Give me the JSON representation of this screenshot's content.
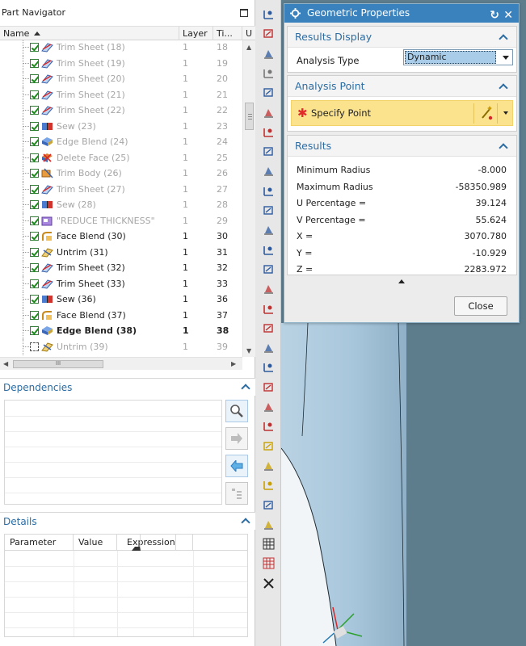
{
  "navigator": {
    "title": "Part Navigator",
    "columns": {
      "name": "Name",
      "layer": "Layer",
      "ti": "Ti...",
      "u": "U"
    },
    "rows": [
      {
        "name": "Trim Sheet (18)",
        "layer": "1",
        "ti": "18",
        "icon": "trim-sheet-icon",
        "dim": true,
        "bold": false
      },
      {
        "name": "Trim Sheet (19)",
        "layer": "1",
        "ti": "19",
        "icon": "trim-sheet-icon",
        "dim": true,
        "bold": false
      },
      {
        "name": "Trim Sheet (20)",
        "layer": "1",
        "ti": "20",
        "icon": "trim-sheet-icon",
        "dim": true,
        "bold": false
      },
      {
        "name": "Trim Sheet (21)",
        "layer": "1",
        "ti": "21",
        "icon": "trim-sheet-icon",
        "dim": true,
        "bold": false
      },
      {
        "name": "Trim Sheet (22)",
        "layer": "1",
        "ti": "22",
        "icon": "trim-sheet-icon",
        "dim": true,
        "bold": false
      },
      {
        "name": "Sew (23)",
        "layer": "1",
        "ti": "23",
        "icon": "sew-icon",
        "dim": true,
        "bold": false
      },
      {
        "name": "Edge Blend (24)",
        "layer": "1",
        "ti": "24",
        "icon": "edge-blend-icon",
        "dim": true,
        "bold": false
      },
      {
        "name": "Delete Face (25)",
        "layer": "1",
        "ti": "25",
        "icon": "delete-face-icon",
        "dim": true,
        "bold": false
      },
      {
        "name": "Trim Body (26)",
        "layer": "1",
        "ti": "26",
        "icon": "trim-body-icon",
        "dim": true,
        "bold": false
      },
      {
        "name": "Trim Sheet (27)",
        "layer": "1",
        "ti": "27",
        "icon": "trim-sheet-icon",
        "dim": true,
        "bold": false
      },
      {
        "name": "Sew (28)",
        "layer": "1",
        "ti": "28",
        "icon": "sew-icon",
        "dim": true,
        "bold": false
      },
      {
        "name": "\"REDUCE THICKNESS\"",
        "layer": "1",
        "ti": "29",
        "icon": "group-icon",
        "dim": true,
        "bold": false
      },
      {
        "name": "Face Blend (30)",
        "layer": "1",
        "ti": "30",
        "icon": "face-blend-icon",
        "dim": false,
        "bold": false
      },
      {
        "name": "Untrim (31)",
        "layer": "1",
        "ti": "31",
        "icon": "untrim-icon",
        "dim": false,
        "bold": false
      },
      {
        "name": "Trim Sheet (32)",
        "layer": "1",
        "ti": "32",
        "icon": "trim-sheet-icon",
        "dim": false,
        "bold": false
      },
      {
        "name": "Trim Sheet (33)",
        "layer": "1",
        "ti": "33",
        "icon": "trim-sheet-icon",
        "dim": false,
        "bold": false
      },
      {
        "name": "Sew (36)",
        "layer": "1",
        "ti": "36",
        "icon": "sew-icon",
        "dim": false,
        "bold": false
      },
      {
        "name": "Face Blend (37)",
        "layer": "1",
        "ti": "37",
        "icon": "face-blend-icon",
        "dim": false,
        "bold": false
      },
      {
        "name": "Edge Blend (38)",
        "layer": "1",
        "ti": "38",
        "icon": "edge-blend-icon",
        "dim": false,
        "bold": true
      },
      {
        "name": "Untrim (39)",
        "layer": "1",
        "ti": "39",
        "icon": "untrim-icon",
        "dim": true,
        "bold": false,
        "unchecked": true
      }
    ],
    "scroll_thumb_label": "III"
  },
  "dependencies": {
    "title": "Dependencies"
  },
  "details": {
    "title": "Details",
    "columns": {
      "parameter": "Parameter",
      "value": "Value",
      "expression": "Expression"
    }
  },
  "dialog": {
    "title": "Geometric Properties",
    "results_display": {
      "title": "Results Display",
      "analysis_type_label": "Analysis Type",
      "analysis_type_value": "Dynamic"
    },
    "analysis_point": {
      "title": "Analysis Point",
      "specify_label": "Specify Point"
    },
    "results": {
      "title": "Results",
      "rows": [
        {
          "label": "Minimum Radius",
          "value": "-8.000"
        },
        {
          "label": "Maximum Radius",
          "value": "-58350.989"
        },
        {
          "label": "U Percentage =",
          "value": "39.124"
        },
        {
          "label": "V Percentage =",
          "value": "55.624"
        },
        {
          "label": "X =",
          "value": "3070.780"
        },
        {
          "label": "Y =",
          "value": "-10.929"
        },
        {
          "label": "Z =",
          "value": "2283.972"
        }
      ]
    },
    "close_label": "Close"
  },
  "colors": {
    "accent": "#2b6ca3",
    "titlebar": "#3a82bd",
    "viewport_bg": "#5d7c8c",
    "part_surface": "#a9c7dc",
    "highlight": "#fbe38e"
  }
}
